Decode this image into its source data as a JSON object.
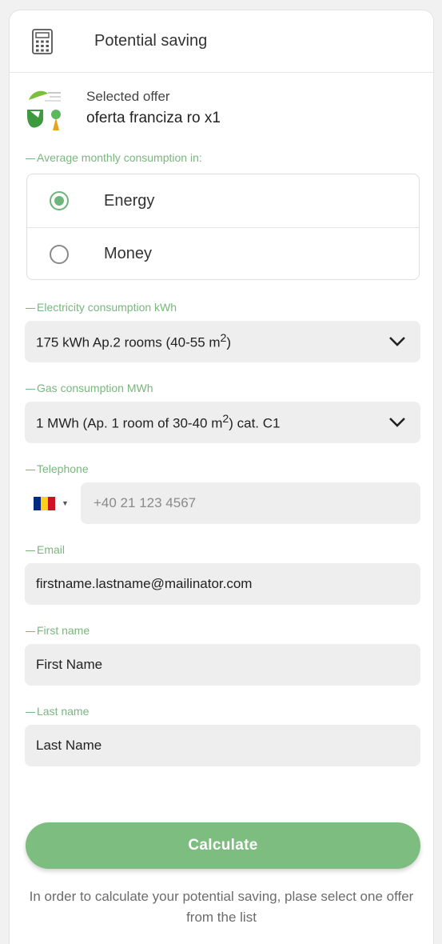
{
  "header": {
    "title": "Potential saving",
    "icon": "calculator-icon"
  },
  "offer": {
    "label": "Selected offer",
    "name": "oferta franciza ro x1",
    "logo": "offer-logo"
  },
  "consumption": {
    "label": "Average monthly consumption in:",
    "options": [
      {
        "label": "Energy",
        "selected": true
      },
      {
        "label": "Money",
        "selected": false
      }
    ]
  },
  "electricity": {
    "label": "Electricity consumption kWh",
    "value_prefix": "175 kWh Ap.2 rooms (40-55 m",
    "value_sup": "2",
    "value_suffix": ")"
  },
  "gas": {
    "label": "Gas consumption MWh",
    "value_prefix": "1 MWh (Ap. 1 room of 30-40 m",
    "value_sup": "2",
    "value_suffix": ") cat. C1"
  },
  "telephone": {
    "label": "Telephone",
    "placeholder": "+40 21 123 4567",
    "flag_colors": [
      "#002b7f",
      "#fcd116",
      "#ce1126"
    ]
  },
  "email": {
    "label": "Email",
    "value": "firstname.lastname@mailinator.com"
  },
  "first_name": {
    "label": "First name",
    "value": "First Name"
  },
  "last_name": {
    "label": "Last name",
    "value": "Last Name"
  },
  "calculate": {
    "label": "Calculate"
  },
  "note": "In order to calculate your potential saving, plase select one offer from the list",
  "colors": {
    "accent": "#7dbd7f",
    "label_green": "#7ab67e",
    "field_bg": "#eeeeee"
  }
}
